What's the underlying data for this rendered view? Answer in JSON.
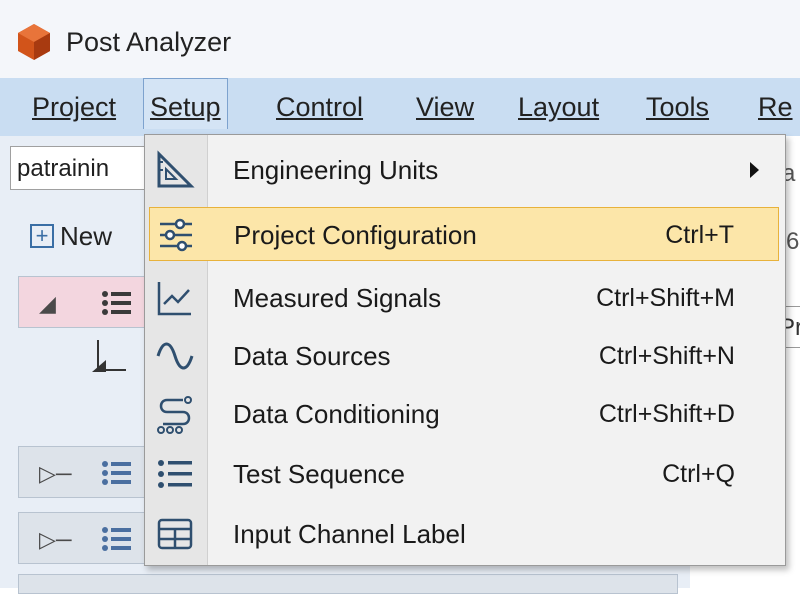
{
  "app": {
    "title": "Post Analyzer"
  },
  "menubar": {
    "items": [
      {
        "label": "Project",
        "mnemonic": "P"
      },
      {
        "label": "Setup",
        "mnemonic": "S"
      },
      {
        "label": "Control",
        "mnemonic": "C"
      },
      {
        "label": "View",
        "mnemonic": "V"
      },
      {
        "label": "Layout",
        "mnemonic": "L"
      },
      {
        "label": "Tools",
        "mnemonic": "o"
      },
      {
        "label": "Re",
        "mnemonic": "R"
      }
    ]
  },
  "project_combo": {
    "value": "patrainin"
  },
  "new_button": {
    "label": "New"
  },
  "tooltip": {
    "text": "Pr"
  },
  "right_edge": {
    "a": "a",
    "b": "6"
  },
  "setup_menu": {
    "items": [
      {
        "label": "Engineering Units",
        "shortcut": "",
        "icon": "triangle-ruler-icon",
        "has_submenu": true
      },
      {
        "label": "Project Configuration",
        "shortcut": "Ctrl+T",
        "icon": "sliders-icon",
        "highlighted": true
      },
      {
        "label": "Measured Signals",
        "shortcut": "Ctrl+Shift+M",
        "icon": "line-chart-icon"
      },
      {
        "label": "Data Sources",
        "shortcut": "Ctrl+Shift+N",
        "icon": "sine-wave-icon"
      },
      {
        "label": "Data Conditioning",
        "shortcut": "Ctrl+Shift+D",
        "icon": "signal-flow-icon"
      },
      {
        "label": "Test Sequence",
        "shortcut": "Ctrl+Q",
        "icon": "bullet-list-icon"
      },
      {
        "label": "Input Channel Label",
        "shortcut": "",
        "icon": "table-grid-icon"
      }
    ]
  },
  "colors": {
    "menubar_bg": "#c9ddf2",
    "highlight_bg": "#fce6a9",
    "highlight_border": "#e8b23b",
    "logo": "#d2541a"
  }
}
